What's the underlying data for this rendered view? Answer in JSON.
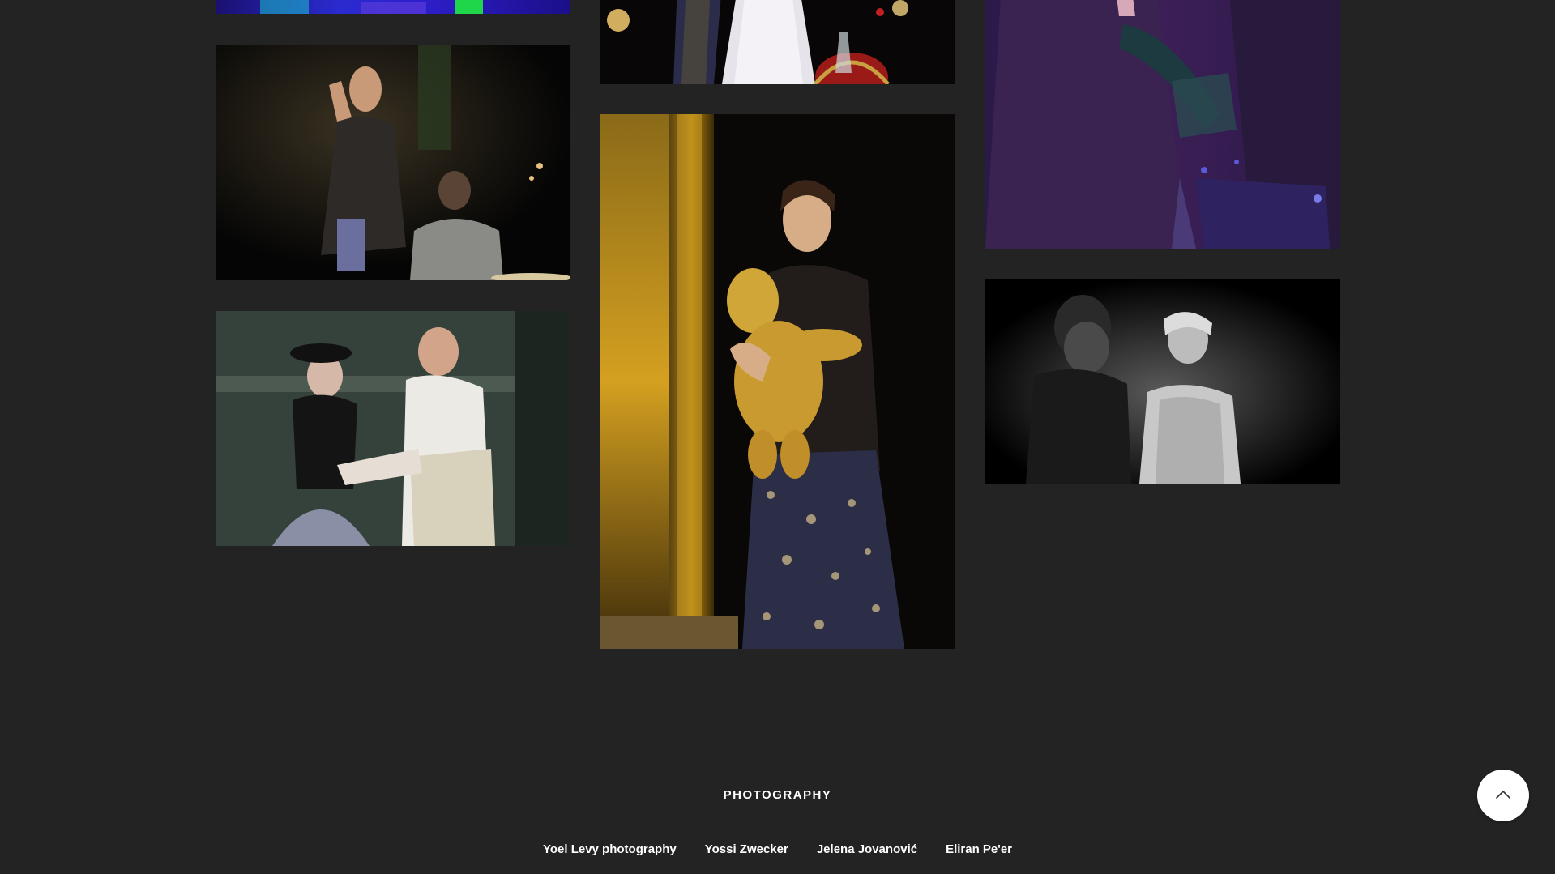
{
  "gallery": {
    "photos": [
      {
        "name": "gallery-photo-stage-blue"
      },
      {
        "name": "gallery-photo-singer-hand-raised"
      },
      {
        "name": "gallery-photo-duet-couple"
      },
      {
        "name": "gallery-photo-gown-scene"
      },
      {
        "name": "gallery-photo-singer-teddy-bear"
      },
      {
        "name": "gallery-photo-purple-stage"
      },
      {
        "name": "gallery-photo-black-white-duo"
      }
    ]
  },
  "footer": {
    "heading": "PHOTOGRAPHY",
    "credits": [
      "Yoel Levy photography",
      "Yossi Zwecker",
      "Jelena Jovanović",
      "Eliran Pe'er"
    ]
  },
  "back_to_top": {
    "icon": "chevron-up-icon"
  },
  "colors": {
    "background": "#232323",
    "text": "#ffffff",
    "button": "#ffffff"
  }
}
